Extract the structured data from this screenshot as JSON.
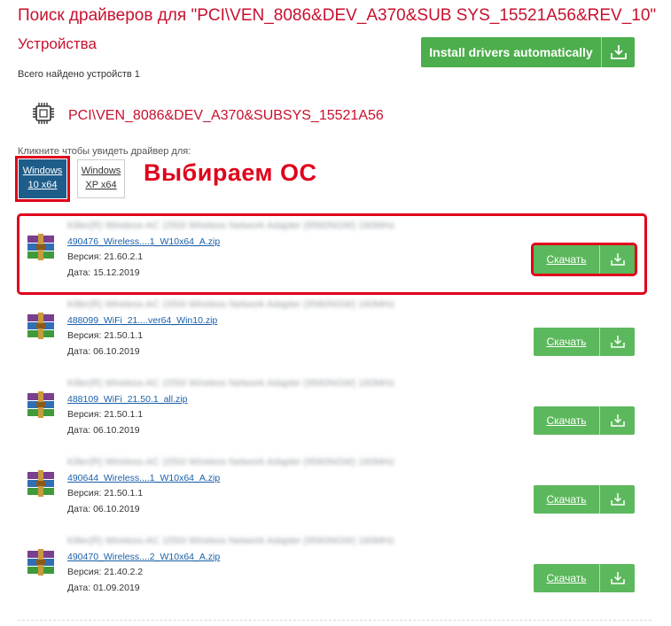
{
  "header": {
    "title": "Поиск драйверов для \"PCI\\VEN_8086&DEV_A370&SUB SYS_15521A56&REV_10\"",
    "section": "Устройства",
    "install_label": "Install drivers automatically",
    "found_count": "Всего найдено устройств 1"
  },
  "device": {
    "name": "PCI\\VEN_8086&DEV_A370&SUBSYS_15521A56"
  },
  "os_selector": {
    "hint": "Кликните чтобы увидеть драйвер для:",
    "options": [
      {
        "line1": "Windows",
        "line2": "10 x64",
        "selected": true
      },
      {
        "line1": "Windows",
        "line2": "XP x64",
        "selected": false
      }
    ],
    "annotation": "Выбираем ОС"
  },
  "drivers": [
    {
      "name": "Killer(R) Wireless-AC 1550i Wireless Network Adapter (9560NGW) 160MHz",
      "file": "490476_Wireless....1_W10x64_A.zip",
      "version": "Версия: 21.60.2.1",
      "date": "Дата: 15.12.2019",
      "download_label": "Скачать"
    },
    {
      "name": "Killer(R) Wireless-AC 1550i Wireless Network Adapter (9560NGW) 160MHz",
      "file": "488099_WiFi_21....ver64_Win10.zip",
      "version": "Версия: 21.50.1.1",
      "date": "Дата: 06.10.2019",
      "download_label": "Скачать"
    },
    {
      "name": "Killer(R) Wireless-AC 1550i Wireless Network Adapter (9560NGW) 160MHz",
      "file": "488109_WiFi_21.50.1_all.zip",
      "version": "Версия: 21.50.1.1",
      "date": "Дата: 06.10.2019",
      "download_label": "Скачать"
    },
    {
      "name": "Killer(R) Wireless-AC 1550i Wireless Network Adapter (9560NGW) 160MHz",
      "file": "490644_Wireless....1_W10x64_A.zip",
      "version": "Версия: 21.50.1.1",
      "date": "Дата: 06.10.2019",
      "download_label": "Скачать"
    },
    {
      "name": "Killer(R) Wireless-AC 1550i Wireless Network Adapter (9560NGW) 160MHz",
      "file": "490470_Wireless....2_W10x64_A.zip",
      "version": "Версия: 21.40.2.2",
      "date": "Дата: 01.09.2019",
      "download_label": "Скачать"
    }
  ],
  "colors": {
    "title_red": "#c8102e",
    "annotation_red": "#e0001b",
    "button_green": "#5cb85c",
    "os_selected_blue": "#1e5d8a",
    "link_blue": "#1a5fa8"
  },
  "icons": {
    "device": "chip-icon",
    "driver_file": "winrar-archive-icon",
    "download": "download-icon"
  }
}
